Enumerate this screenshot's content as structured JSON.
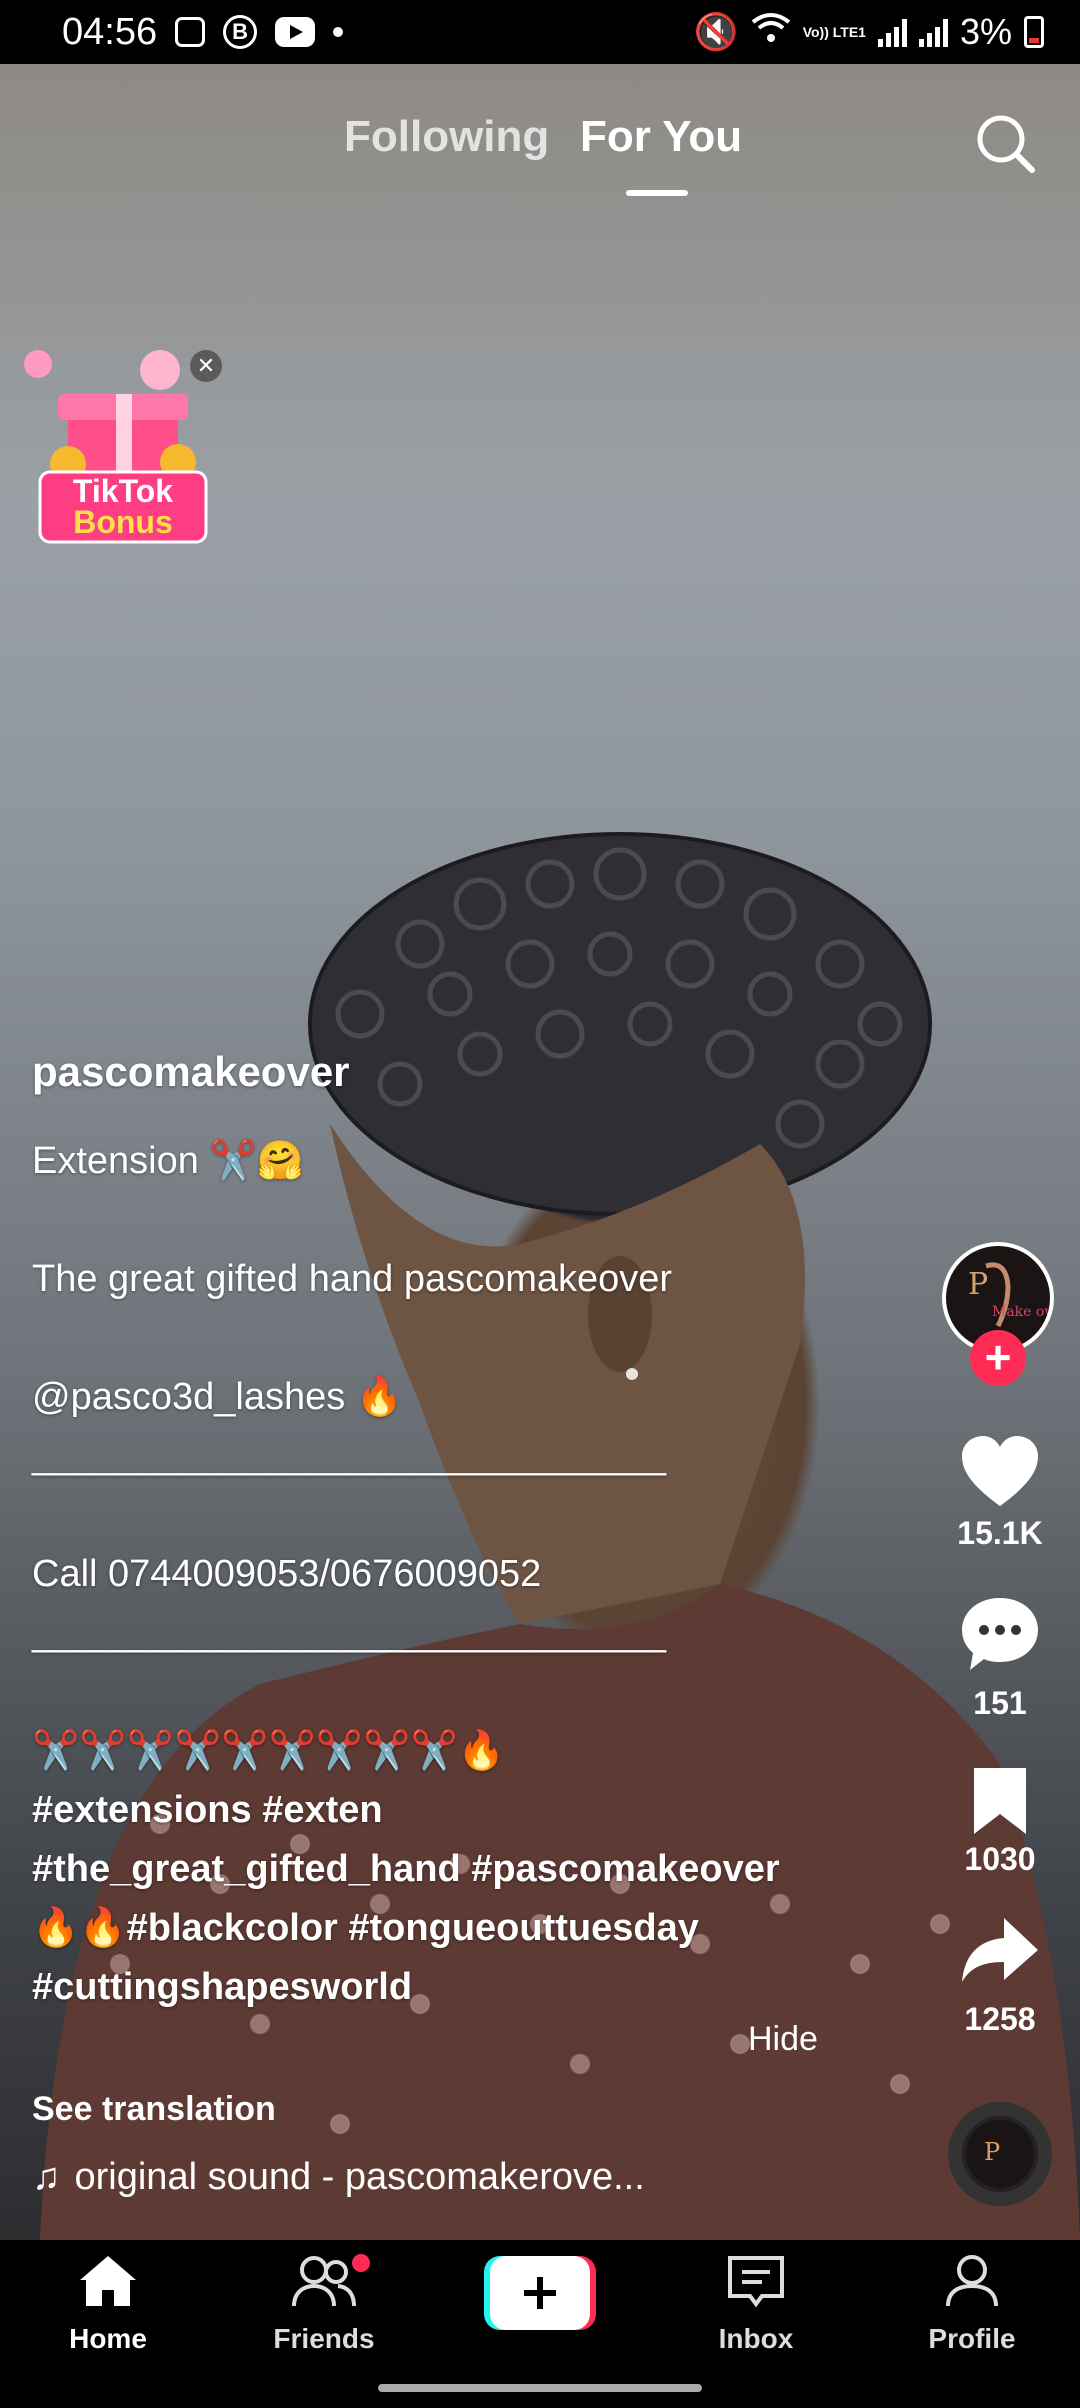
{
  "status_bar": {
    "time": "04:56",
    "b_badge": "B",
    "lte_label": "Vo)) LTE1",
    "battery": "3%"
  },
  "top_nav": {
    "following": "Following",
    "for_you": "For You"
  },
  "bonus": {
    "line1": "TikTok",
    "line2": "Bonus"
  },
  "post": {
    "username": "pascomakeover",
    "caption_lines": [
      "Extension ✂️🤗",
      "",
      "The great gifted hand pascomakeover",
      "",
      "@pasco3d_lashes 🔥",
      "______________________________",
      "",
      "Call 0744009053/0676009052",
      "______________________________",
      "",
      "✂️✂️✂️✂️✂️✂️✂️✂️✂️🔥",
      "#extensions #exten",
      "#the_great_gifted_hand #pascomakeover",
      "🔥🔥#blackcolor #tongueouttuesday",
      "#cuttingshapesworld"
    ],
    "hide_label": "Hide",
    "see_translation": "See translation",
    "sound": "original sound - pascomakerove..."
  },
  "actions": {
    "likes": "15.1K",
    "comments": "151",
    "bookmarks": "1030",
    "shares": "1258"
  },
  "bottom_nav": {
    "home": "Home",
    "friends": "Friends",
    "inbox": "Inbox",
    "profile": "Profile"
  },
  "colors": {
    "accent_pink": "#fe2c55",
    "accent_cyan": "#25f4ee"
  }
}
